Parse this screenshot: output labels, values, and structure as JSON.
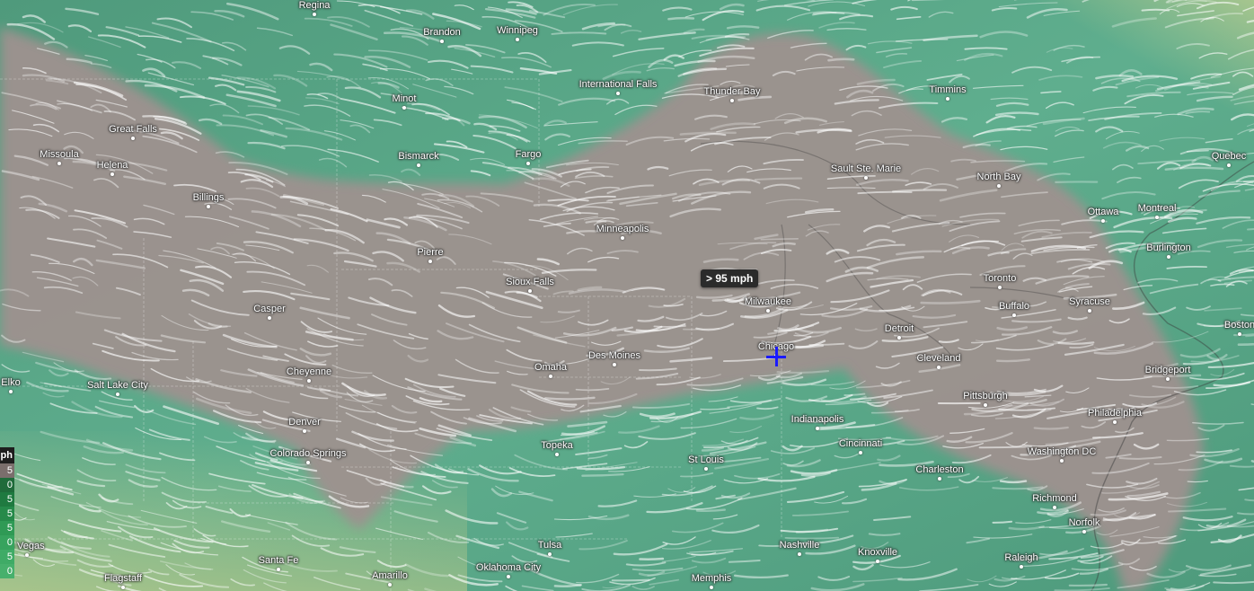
{
  "tooltip": "> 95 mph",
  "legend": {
    "unit": "ph",
    "steps": [
      {
        "label": "5",
        "color": "#7a6e6c"
      },
      {
        "label": "0",
        "color": "#1f6b3a"
      },
      {
        "label": "5",
        "color": "#1f7a40"
      },
      {
        "label": "5",
        "color": "#268a4a"
      },
      {
        "label": "5",
        "color": "#2f9a55"
      },
      {
        "label": "0",
        "color": "#37a35e"
      },
      {
        "label": "5",
        "color": "#3fab66"
      },
      {
        "label": "0",
        "color": "#47b06c"
      }
    ]
  },
  "colors": {
    "jet_core": "#9e928f",
    "wind_green": "#5fa58a",
    "wind_light": "#8fc9ad",
    "crosshair": "#1a1aff",
    "calm_yellow": "#b7c98a"
  },
  "cities": [
    {
      "name": "Regina"
    },
    {
      "name": "Brandon"
    },
    {
      "name": "Winnipeg"
    },
    {
      "name": "International Falls"
    },
    {
      "name": "Thunder Bay"
    },
    {
      "name": "Timmins"
    },
    {
      "name": "Minot"
    },
    {
      "name": "Great Falls"
    },
    {
      "name": "Missoula"
    },
    {
      "name": "Helena"
    },
    {
      "name": "Bismarck"
    },
    {
      "name": "Fargo"
    },
    {
      "name": "Sault Ste. Marie"
    },
    {
      "name": "North Bay"
    },
    {
      "name": "Quebec"
    },
    {
      "name": "Ottawa"
    },
    {
      "name": "Montreal"
    },
    {
      "name": "Billings"
    },
    {
      "name": "Minneapolis"
    },
    {
      "name": "Burlington"
    },
    {
      "name": "Pierre"
    },
    {
      "name": "Sioux Falls"
    },
    {
      "name": "Toronto"
    },
    {
      "name": "Casper"
    },
    {
      "name": "Milwaukee"
    },
    {
      "name": "Buffalo"
    },
    {
      "name": "Syracuse"
    },
    {
      "name": "Boston"
    },
    {
      "name": "Detroit"
    },
    {
      "name": "Chicago"
    },
    {
      "name": "Des Moines"
    },
    {
      "name": "Omaha"
    },
    {
      "name": "Cheyenne"
    },
    {
      "name": "Cleveland"
    },
    {
      "name": "Bridgeport"
    },
    {
      "name": "Elko"
    },
    {
      "name": "Salt Lake City"
    },
    {
      "name": "Pittsburgh"
    },
    {
      "name": "Denver"
    },
    {
      "name": "Indianapolis"
    },
    {
      "name": "Philadelphia"
    },
    {
      "name": "Cincinnati"
    },
    {
      "name": "Topeka"
    },
    {
      "name": "Washington DC"
    },
    {
      "name": "Colorado Springs"
    },
    {
      "name": "St Louis"
    },
    {
      "name": "Charleston"
    },
    {
      "name": "Richmond"
    },
    {
      "name": "Norfolk"
    },
    {
      "name": "Tulsa"
    },
    {
      "name": "Nashville"
    },
    {
      "name": "Knoxville"
    },
    {
      "name": "Raleigh"
    },
    {
      "name": "Santa Fe"
    },
    {
      "name": "Oklahoma City"
    },
    {
      "name": "Amarillo"
    },
    {
      "name": "Memphis"
    },
    {
      "name": "Flagstaff"
    },
    {
      "name": "s Vegas"
    }
  ]
}
